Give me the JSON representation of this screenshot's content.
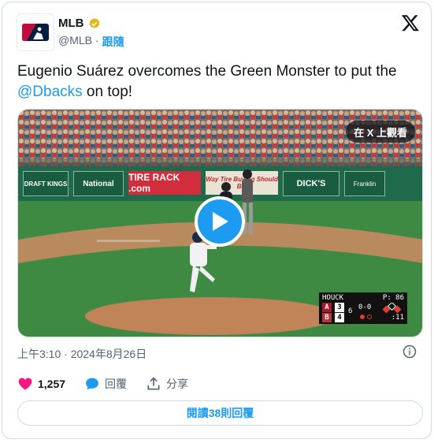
{
  "author": {
    "name": "MLB",
    "handle": "@MLB",
    "separator": "·",
    "follow_label": "跟隨"
  },
  "tweet": {
    "text_before": "Eugenio Suárez overcomes the Green Monster to put the ",
    "mention": "@Dbacks",
    "text_after": " on top!"
  },
  "media": {
    "watch_on_x": "在 X 上觀看",
    "wall_ads": [
      "DRAFT KINGS",
      "National",
      "TIRE RACK .com",
      "Way Tire Buying Should Be.",
      "DICK'S",
      "Franklin"
    ],
    "scorebug": {
      "pitcher": "HOUCK",
      "pitch_count": "P: 86",
      "away_team": "A",
      "away_runs": "3",
      "home_team": "B",
      "home_runs": "4",
      "inning": "6",
      "count": "0-0",
      "clock": ":11"
    }
  },
  "timestamp": "上午3:10 · 2024年8月26日",
  "actions": {
    "likes": "1,257",
    "reply_label": "回覆",
    "share_label": "分享"
  },
  "replies_button": {
    "prefix": "閱讀 ",
    "count": "38",
    "suffix": " 則回覆"
  },
  "colors": {
    "accent": "#1d9bf0",
    "like": "#f91880",
    "muted": "#536471"
  }
}
